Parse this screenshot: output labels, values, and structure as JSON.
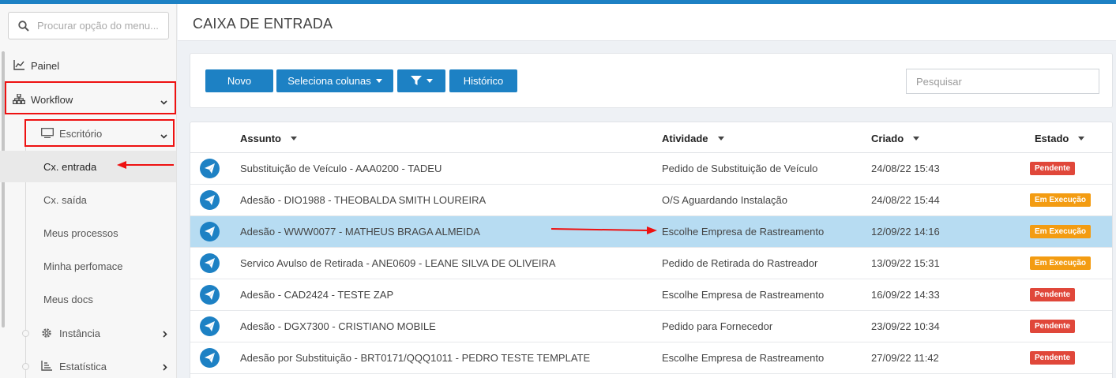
{
  "sidebar": {
    "search_placeholder": "Procurar opção do menu...",
    "painel": "Painel",
    "workflow": "Workflow",
    "escritorio": "Escritório",
    "items": [
      "Cx. entrada",
      "Cx. saída",
      "Meus processos",
      "Minha perfomace",
      "Meus docs"
    ],
    "instancia": "Instância",
    "estatistica": "Estatística"
  },
  "header": {
    "title": "CAIXA DE ENTRADA"
  },
  "toolbar": {
    "novo": "Novo",
    "seleciona_colunas": "Seleciona colunas",
    "historico": "Histórico",
    "search_placeholder": "Pesquisar"
  },
  "table": {
    "columns": [
      "Assunto",
      "Atividade",
      "Criado",
      "Estado"
    ],
    "rows": [
      {
        "assunto": "Substituição de Veículo - AAA0200 - TADEU",
        "atividade": "Pedido de Substituição de Veículo",
        "criado": "24/08/22 15:43",
        "estado": "Pendente"
      },
      {
        "assunto": "Adesão - DIO1988 - THEOBALDA SMITH LOUREIRA",
        "atividade": "O/S Aguardando Instalação",
        "criado": "24/08/22 15:44",
        "estado": "Em Execução"
      },
      {
        "assunto": "Adesão - WWW0077 - MATHEUS BRAGA ALMEIDA",
        "atividade": "Escolhe Empresa de Rastreamento",
        "criado": "12/09/22 14:16",
        "estado": "Em Execução"
      },
      {
        "assunto": "Servico Avulso de Retirada - ANE0609 - LEANE SILVA DE OLIVEIRA",
        "atividade": "Pedido de Retirada do Rastreador",
        "criado": "13/09/22 15:31",
        "estado": "Em Execução"
      },
      {
        "assunto": "Adesão - CAD2424 - TESTE ZAP",
        "atividade": "Escolhe Empresa de Rastreamento",
        "criado": "16/09/22 14:33",
        "estado": "Pendente"
      },
      {
        "assunto": "Adesão - DGX7300 - CRISTIANO MOBILE",
        "atividade": "Pedido para Fornecedor",
        "criado": "23/09/22 10:34",
        "estado": "Pendente"
      },
      {
        "assunto": "Adesão por Substituição - BRT0171/QQQ1011 - PEDRO TESTE TEMPLATE",
        "atividade": "Escolhe Empresa de Rastreamento",
        "criado": "27/09/22 11:42",
        "estado": "Pendente"
      }
    ]
  },
  "colors": {
    "primary": "#1d81c4",
    "pending": "#e0473a",
    "executing": "#f39c12",
    "selected_row": "#b7dcf2",
    "annotation": "#e11111"
  }
}
